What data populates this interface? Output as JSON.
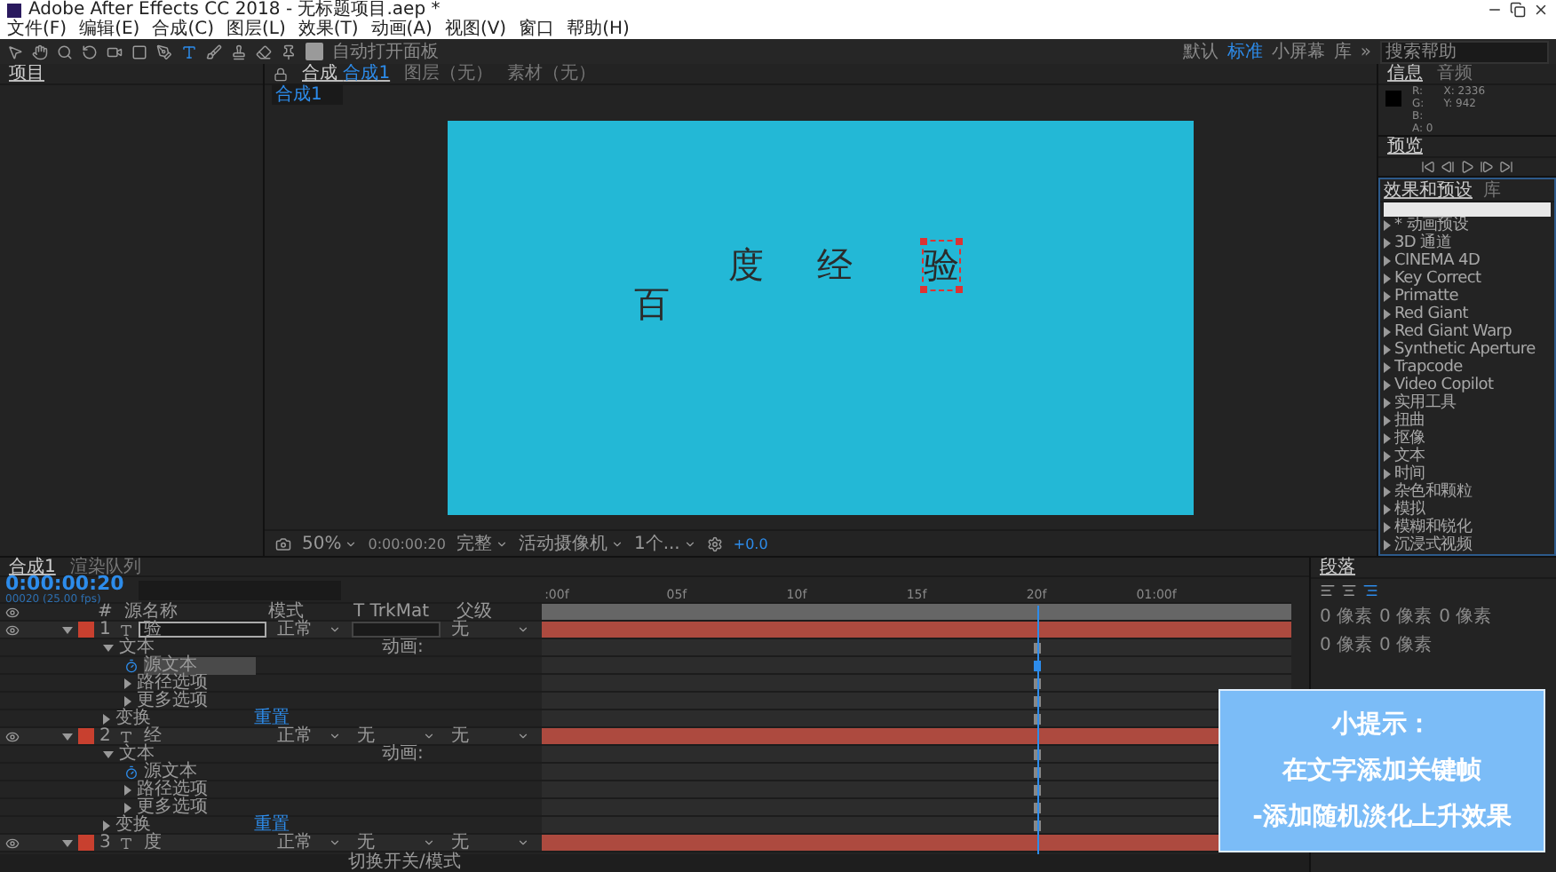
{
  "window": {
    "title": "Adobe After Effects CC 2018 - 无标题项目.aep *"
  },
  "menu": [
    "文件(F)",
    "编辑(E)",
    "合成(C)",
    "图层(L)",
    "效果(T)",
    "动画(A)",
    "视图(V)",
    "窗口",
    "帮助(H)"
  ],
  "toolbar": {
    "auto_open": {
      "label": "自动打开面板",
      "checked": true
    }
  },
  "workspaces": [
    {
      "label": "默认",
      "selected": false
    },
    {
      "label": "标准",
      "selected": true
    },
    {
      "label": "小屏幕",
      "selected": false
    },
    {
      "label": "库",
      "selected": false
    }
  ],
  "workspace_more": "»",
  "help_search": {
    "placeholder": "搜索帮助"
  },
  "project": {
    "title": "项目"
  },
  "viewer": {
    "tabs": [
      {
        "label": "合成",
        "value": "合成1",
        "selected": true
      },
      {
        "label": "图层（无）",
        "selected": false
      },
      {
        "label": "素材（无）",
        "selected": false
      }
    ],
    "subtab": "合成1",
    "letters": [
      {
        "char": "百",
        "selected": false
      },
      {
        "char": "度",
        "selected": false
      },
      {
        "char": "经",
        "selected": false
      },
      {
        "char": "验",
        "selected": true
      }
    ],
    "controls": {
      "zoom": "50%",
      "time": "0:00:00:20",
      "resolution": "完整",
      "camera": "活动摄像机",
      "views": "1个...",
      "exposure": "+0.0"
    }
  },
  "info": {
    "tabs": [
      {
        "label": "信息",
        "selected": true
      },
      {
        "label": "音频",
        "selected": false
      }
    ],
    "channels": [
      "R:",
      "G:",
      "B:",
      "A: 0"
    ],
    "coords": [
      "X: 2336",
      "Y: 942"
    ]
  },
  "preview": {
    "title": "预览"
  },
  "effects": {
    "tabs": [
      {
        "label": "效果和预设",
        "selected": true
      },
      {
        "label": "库",
        "selected": false
      }
    ],
    "items": [
      "* 动画预设",
      "3D 通道",
      "CINEMA 4D",
      "Key Correct",
      "Primatte",
      "Red Giant",
      "Red Giant Warp",
      "Synthetic Aperture",
      "Trapcode",
      "Video Copilot",
      "实用工具",
      "扭曲",
      "抠像",
      "文本",
      "时间",
      "杂色和颗粒",
      "模拟",
      "模糊和锐化",
      "沉浸式视频"
    ]
  },
  "timeline": {
    "tabs": [
      {
        "label": "合成1",
        "selected": true
      },
      {
        "label": "渲染队列",
        "selected": false
      }
    ],
    "timecode": "0:00:00:20",
    "frame_info": "00020 (25.00 fps)",
    "columns": [
      "#",
      "源名称",
      "模式",
      "T TrkMat",
      "父级"
    ],
    "ruler": [
      ":00f",
      "05f",
      "10f",
      "15f",
      "20f",
      "01:00f"
    ],
    "playhead": {
      "level": 0.8
    },
    "layers": [
      {
        "number": "1",
        "name": "验",
        "color": "#c8402f",
        "expanded": true,
        "mode": "正常",
        "parent": "无",
        "properties": [
          {
            "label": "文本",
            "kind": "group",
            "expanded": true,
            "selected": false,
            "action": "动画:",
            "children": [
              {
                "label": "源文本",
                "kind": "stopwatch",
                "selected": true
              },
              {
                "label": "路径选项",
                "kind": "group",
                "expanded": false,
                "selected": false
              },
              {
                "label": "更多选项",
                "kind": "group",
                "expanded": false,
                "selected": false
              }
            ]
          },
          {
            "label": "变换",
            "kind": "group",
            "expanded": false,
            "selected": false,
            "action": "重置"
          }
        ]
      },
      {
        "number": "2",
        "name": "经",
        "color": "#c8402f",
        "expanded": true,
        "mode": "正常",
        "trkmat": "无",
        "parent": "无",
        "properties": [
          {
            "label": "文本",
            "kind": "group",
            "expanded": true,
            "selected": false,
            "action": "动画:",
            "children": [
              {
                "label": "源文本",
                "kind": "stopwatch",
                "selected": false
              },
              {
                "label": "路径选项",
                "kind": "group",
                "expanded": false,
                "selected": false
              },
              {
                "label": "更多选项",
                "kind": "group",
                "expanded": false,
                "selected": false
              }
            ]
          },
          {
            "label": "变换",
            "kind": "group",
            "expanded": false,
            "selected": false,
            "action": "重置"
          }
        ]
      },
      {
        "number": "3",
        "name": "度",
        "color": "#c8402f",
        "expanded": true,
        "mode": "正常",
        "trkmat": "无",
        "parent": "无"
      }
    ],
    "footer": "切换开关/模式"
  },
  "paragraph": {
    "title": "段落",
    "fields": [
      "0 像素",
      "0 像素",
      "0 像素",
      "0 像素",
      "0 像素"
    ]
  },
  "tip": {
    "title": "小提示：",
    "lines": [
      "在文字添加关键帧",
      "-添加随机淡化上升效果"
    ]
  }
}
